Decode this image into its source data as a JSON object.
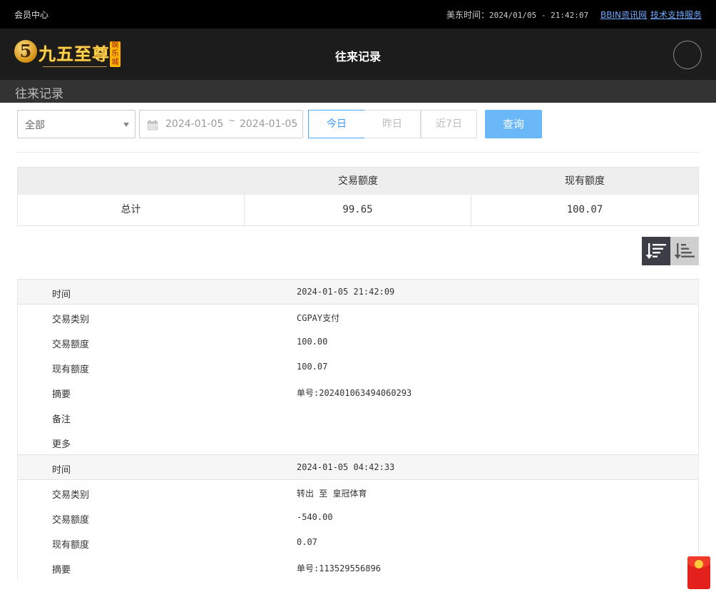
{
  "topbar": {
    "member_center": "会员中心",
    "time_label": "美东时间：",
    "time_value": "2024/01/05 - 21:42:07",
    "link_news": "BBIN资讯网",
    "link_support": "技术支持服务"
  },
  "header": {
    "logo_mark": "5",
    "logo_name": "九五至尊",
    "logo_tag": "娱乐城",
    "title": "往来记录"
  },
  "subbar": {
    "title": "往来记录"
  },
  "filters": {
    "type_select": "全部",
    "date_start": "2024-01-05",
    "date_sep": "~",
    "date_end": "2024-01-05",
    "btn_today": "今日",
    "btn_yesterday": "昨日",
    "btn_7days": "近7日",
    "btn_query": "查询"
  },
  "summary": {
    "headers": [
      "",
      "交易额度",
      "现有额度"
    ],
    "row": [
      "总计",
      "99.65",
      "100.07"
    ]
  },
  "records": [
    {
      "rows": [
        {
          "label": "时间",
          "value": "2024-01-05 21:42:09"
        },
        {
          "label": "交易类别",
          "value": "CGPAY支付"
        },
        {
          "label": "交易额度",
          "value": "100.00"
        },
        {
          "label": "现有额度",
          "value": "100.07"
        },
        {
          "label": "摘要",
          "value": "单号:202401063494060293"
        },
        {
          "label": "备注",
          "value": ""
        },
        {
          "label": "更多",
          "value": ""
        }
      ]
    },
    {
      "rows": [
        {
          "label": "时间",
          "value": "2024-01-05 04:42:33"
        },
        {
          "label": "交易类别",
          "value": "转出 至 皇冠体育"
        },
        {
          "label": "交易额度",
          "value": "-540.00"
        },
        {
          "label": "现有额度",
          "value": "0.07"
        },
        {
          "label": "摘要",
          "value": "单号:113529556896"
        }
      ]
    }
  ],
  "colors": {
    "accent": "#3399ff",
    "query_button": "#6ab8f7",
    "topbar": "#000000",
    "header": "#1c1c1c",
    "gold": "#ffd34d"
  },
  "icons": [
    "calendar-icon",
    "caret-down-icon",
    "sort-desc-icon",
    "sort-asc-icon",
    "red-packet-icon"
  ]
}
